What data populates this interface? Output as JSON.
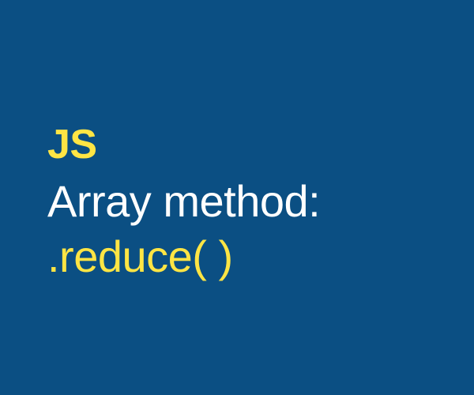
{
  "badge": "JS",
  "title": "Array method:",
  "method": ".reduce( )",
  "colors": {
    "background": "#0b4f83",
    "accent": "#ffe544",
    "text": "#ffffff"
  }
}
